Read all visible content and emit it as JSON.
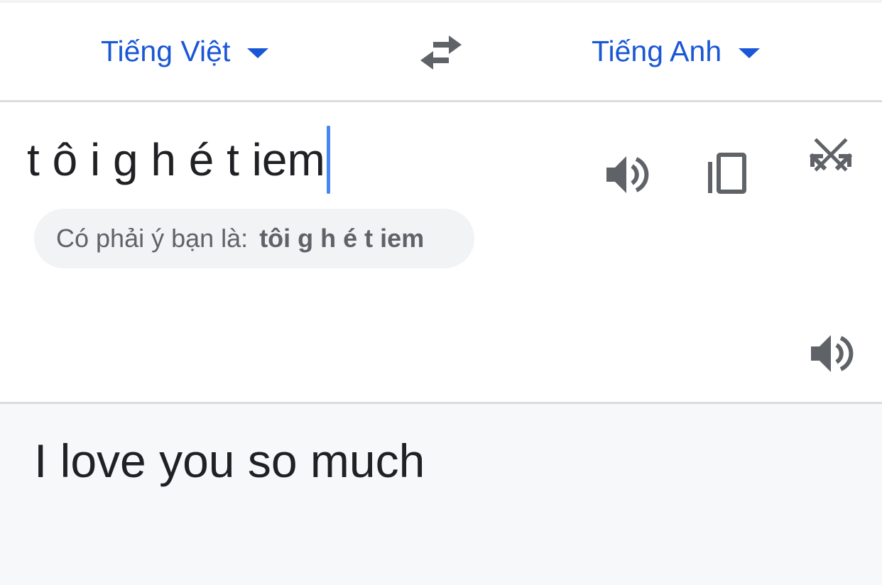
{
  "header": {
    "source_language": "Tiếng Việt",
    "target_language": "Tiếng Anh",
    "icons": {
      "source_dropdown": "chevron-down-icon",
      "swap": "swap-icon",
      "target_dropdown": "chevron-down-icon"
    }
  },
  "input": {
    "value": "t ô i g h é t iem",
    "clear_icon": "close-icon",
    "listen_icon": "speaker-icon"
  },
  "suggestion": {
    "label": "Có phải ý bạn là:",
    "value": "tôi g h é t iem"
  },
  "result": {
    "text": "I love you so much",
    "icons": [
      "speaker-icon",
      "copy-icon",
      "expand-icon"
    ]
  },
  "colors": {
    "accent": "#1a57d6",
    "cursor": "#4a86f0",
    "icon": "#5f6368",
    "result_background": "#f7f8fa",
    "divider": "#dadce0"
  }
}
